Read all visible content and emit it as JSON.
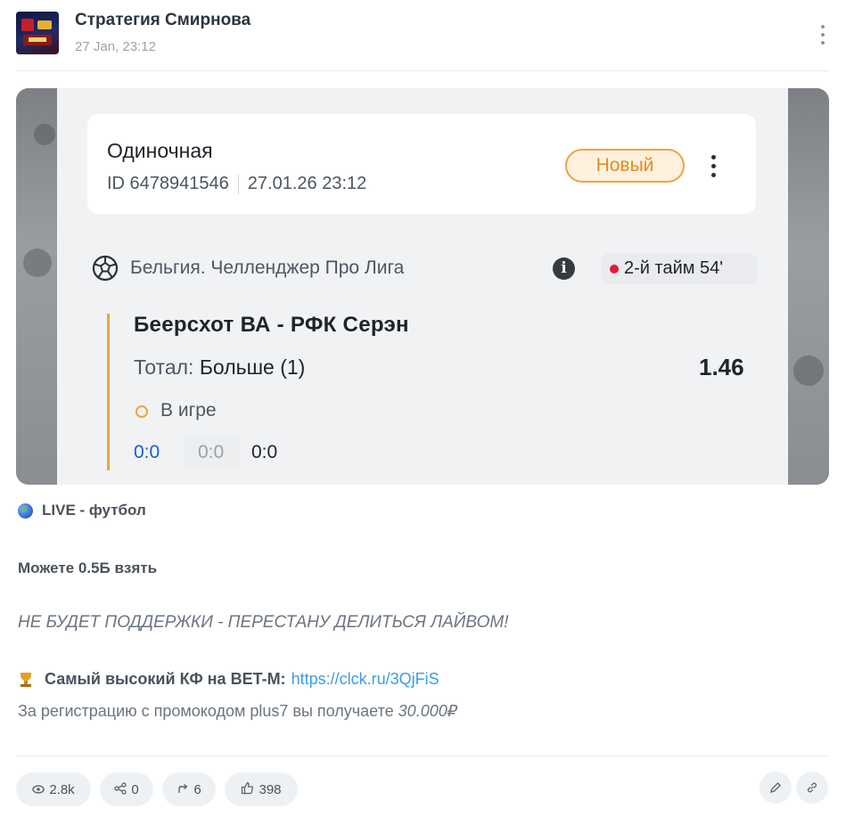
{
  "post": {
    "channel_name": "Стратегия Смирнова",
    "time": "27 Jan, 23:12"
  },
  "bet_card": {
    "type": "Одиночная",
    "id": "ID 6478941546",
    "datetime": "27.01.26 23:12",
    "status_badge": "Новый",
    "league": "Бельгия. Челленджер Про Лига",
    "info_icon": "i",
    "live_status": "2-й тайм 54'",
    "event": "Беерсхот ВА - РФК Серэн",
    "market_label": "Тотал:",
    "market_value": "Больше (1)",
    "odds": "1.46",
    "bet_state": "В игре",
    "scores": [
      "0:0",
      "0:0",
      "0:0"
    ]
  },
  "text": {
    "live_line": "LIVE - футбол",
    "can_take": "Можете 0.5Б взять",
    "warning": "НЕ БУДЕТ ПОДДЕРЖКИ - ПЕРЕСТАНУ ДЕЛИТЬСЯ ЛАЙВОМ!",
    "promo_bold": "Самый высокий КФ на BET-M:",
    "promo_link": "https://clck.ru/3QjFiS",
    "reg_text": "За регистрацию с промокодом plus7 вы получаете",
    "reg_amount": "30.000₽"
  },
  "stats": {
    "views": "2.8k",
    "shares": "0",
    "forwards": "6",
    "likes": "398"
  },
  "colors": {
    "accent_orange": "#f0a341",
    "live_red": "#e3193d",
    "score_blue": "#1a5ec7",
    "link_blue": "#3c9be0"
  },
  "icons": [
    "menu-dots-icon",
    "soccer-ball-icon",
    "info-icon",
    "globe-icon",
    "trophy-icon",
    "eye-icon",
    "share-icon",
    "forward-icon",
    "thumbs-up-icon",
    "edit-icon",
    "link-icon"
  ]
}
